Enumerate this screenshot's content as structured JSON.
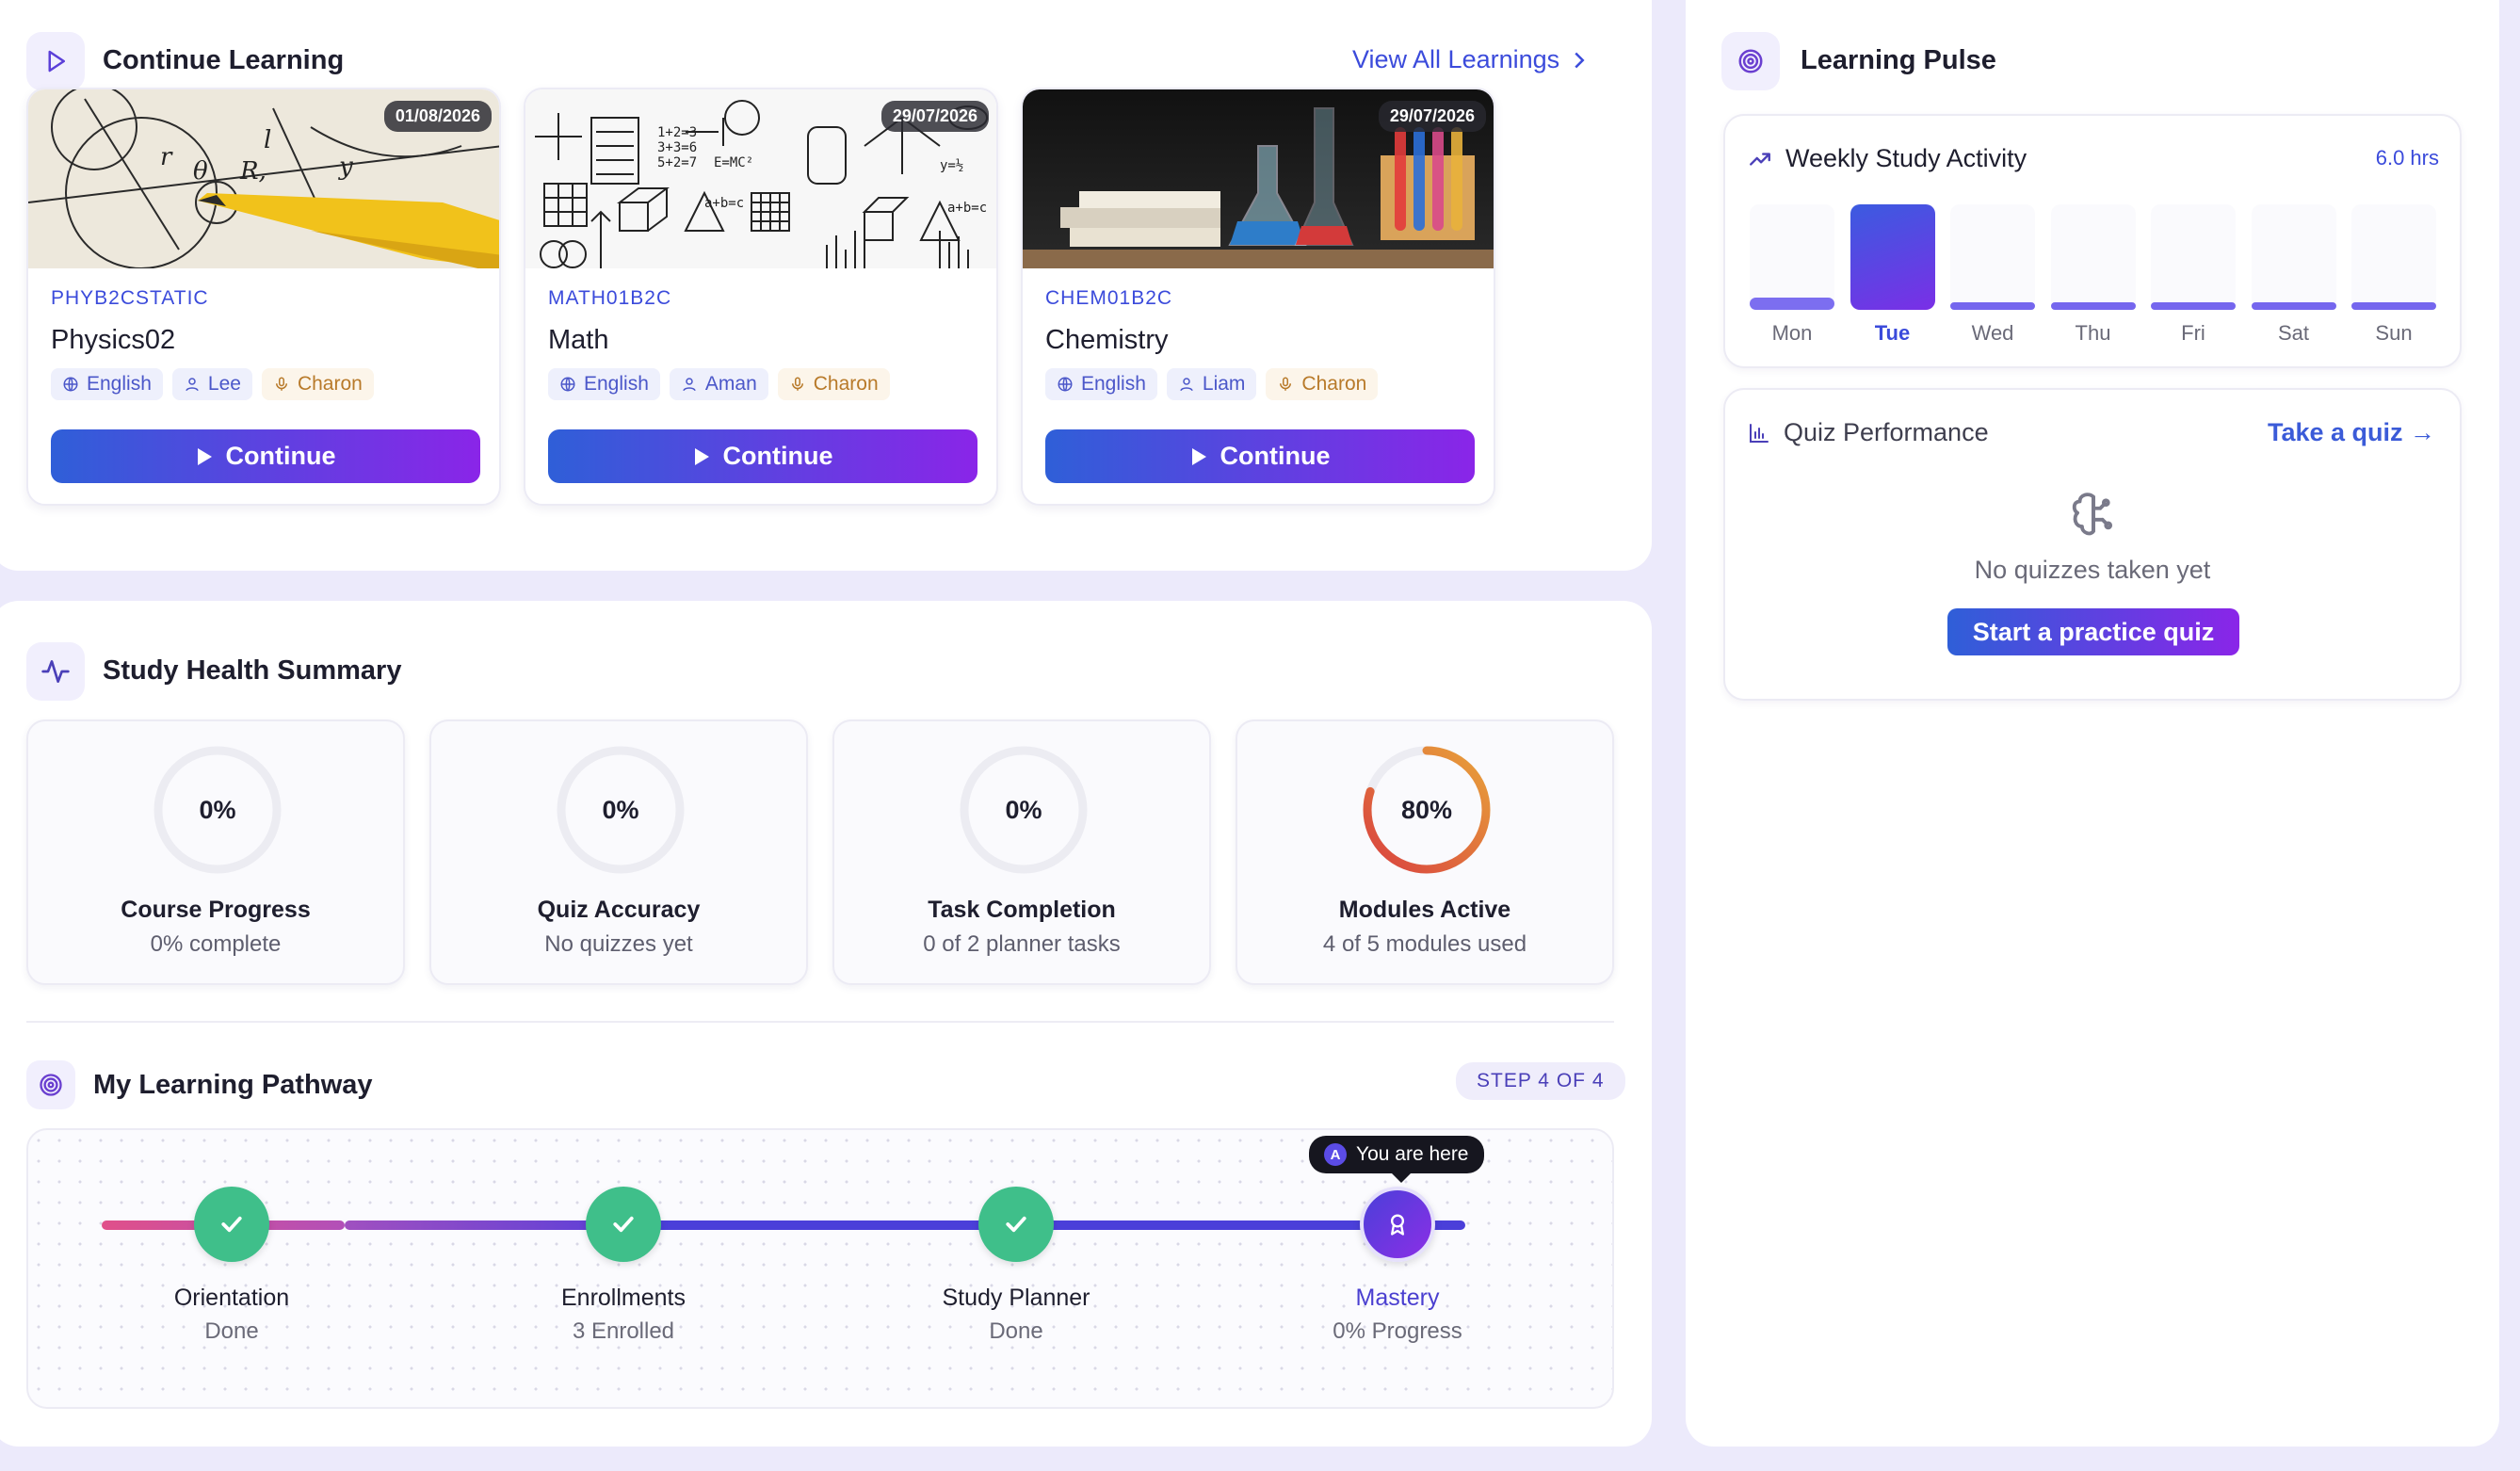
{
  "continue_learning": {
    "title": "Continue Learning",
    "view_all": "View All Learnings",
    "continue_label": "Continue",
    "courses": [
      {
        "date": "01/08/2026",
        "code": "PHYB2CSTATIC",
        "name": "Physics02",
        "language": "English",
        "teacher": "Lee",
        "voice": "Charon"
      },
      {
        "date": "29/07/2026",
        "code": "MATH01B2C",
        "name": "Math",
        "language": "English",
        "teacher": "Aman",
        "voice": "Charon"
      },
      {
        "date": "29/07/2026",
        "code": "CHEM01B2C",
        "name": "Chemistry",
        "language": "English",
        "teacher": "Liam",
        "voice": "Charon"
      }
    ]
  },
  "study_health": {
    "title": "Study Health Summary",
    "metrics": [
      {
        "value": "0%",
        "percent": 0,
        "label": "Course Progress",
        "sub": "0% complete"
      },
      {
        "value": "0%",
        "percent": 0,
        "label": "Quiz Accuracy",
        "sub": "No quizzes yet"
      },
      {
        "value": "0%",
        "percent": 0,
        "label": "Task Completion",
        "sub": "0 of 2 planner tasks"
      },
      {
        "value": "80%",
        "percent": 80,
        "label": "Modules Active",
        "sub": "4 of 5 modules used"
      }
    ]
  },
  "pathway": {
    "title": "My Learning Pathway",
    "step_badge": "STEP 4 OF 4",
    "you_are_here": "You are here",
    "avatar_initial": "A",
    "steps": [
      {
        "label": "Orientation",
        "sub": "Done",
        "status": "done"
      },
      {
        "label": "Enrollments",
        "sub": "3 Enrolled",
        "status": "done"
      },
      {
        "label": "Study Planner",
        "sub": "Done",
        "status": "done"
      },
      {
        "label": "Mastery",
        "sub": "0% Progress",
        "status": "current"
      }
    ]
  },
  "learning_pulse": {
    "title": "Learning Pulse",
    "weekly": {
      "title": "Weekly Study Activity",
      "total": "6.0 hrs",
      "active_day": "Tue",
      "days": [
        {
          "day": "Mon",
          "level": 0.12
        },
        {
          "day": "Tue",
          "level": 1.0
        },
        {
          "day": "Wed",
          "level": 0.05
        },
        {
          "day": "Thu",
          "level": 0.05
        },
        {
          "day": "Fri",
          "level": 0.05
        },
        {
          "day": "Sat",
          "level": 0.05
        },
        {
          "day": "Sun",
          "level": 0.05
        }
      ]
    },
    "quiz": {
      "title": "Quiz Performance",
      "link": "Take a quiz →",
      "empty": "No quizzes taken yet",
      "button": "Start a practice quiz"
    }
  },
  "colors": {
    "accent": "#3B4BDB",
    "gradient_start": "#2F5FD8",
    "gradient_end": "#8A25E8",
    "done_green": "#3FBF8A",
    "ring_track": "#ECECF2"
  }
}
